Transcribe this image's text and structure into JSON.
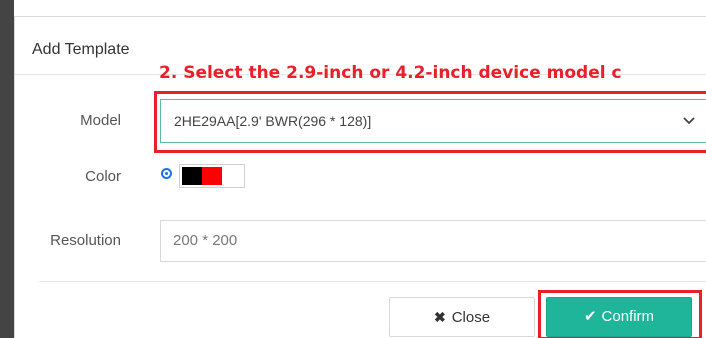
{
  "background_caption": "ad ... sele ... ... vice mo ... ... ... ... ... ... ... ... ... ... ... ...",
  "dialog": {
    "title": "Add Template",
    "annotation_step2": "2. Select the 2.9-inch or 4.2-inch device model c"
  },
  "form": {
    "model_label": "Model",
    "model_value": "2HE29AA[2.9' BWR(296 * 128)]",
    "color_label": "Color",
    "color_swatches": [
      "#000000",
      "#ff0000",
      "#ffffff"
    ],
    "resolution_label": "Resolution",
    "resolution_value": "200 * 200"
  },
  "buttons": {
    "close_label": "Close",
    "close_icon": "times-icon",
    "confirm_label": "Confirm",
    "confirm_icon": "check-icon"
  },
  "colors": {
    "accent": "#1fb59a",
    "highlight": "#e8202a",
    "annotation_text": "#e8202a"
  }
}
